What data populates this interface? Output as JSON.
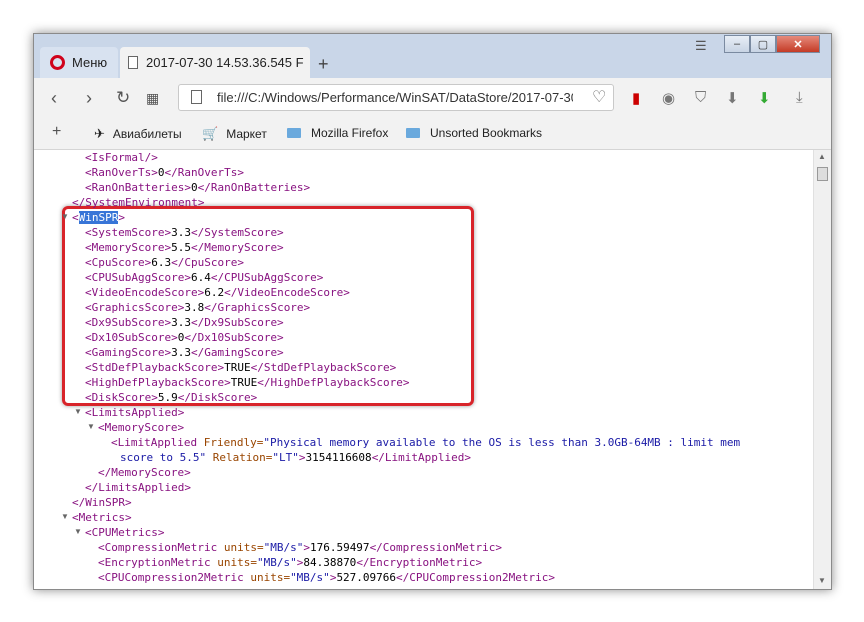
{
  "tabs": {
    "menu_label": "Меню",
    "doc_title": "2017-07-30 14.53.36.545 F"
  },
  "address": {
    "url": "file:///C:/Windows/Performance/WinSAT/DataStore/2017-07-30"
  },
  "bookmarks": [
    {
      "label": "Авиабилеты",
      "icon": "plane-icon"
    },
    {
      "label": "Маркет",
      "icon": "cart-icon"
    },
    {
      "label": "Mozilla Firefox",
      "icon": "folder-icon"
    },
    {
      "label": "Unsorted Bookmarks",
      "icon": "folder-icon"
    }
  ],
  "xml": [
    {
      "o": "<IsFormal/>",
      "v": "",
      "c": ""
    },
    {
      "o": "<RanOverTs>",
      "v": "0",
      "c": "</RanOverTs>"
    },
    {
      "o": "<RanOnBatteries>",
      "v": "0",
      "c": "</RanOnBatteries>"
    },
    {
      "o": "</SystemEnvironment>",
      "v": "",
      "c": ""
    },
    {
      "o": "<",
      "sel": "WinSPR",
      "c": ">"
    },
    {
      "o": "<SystemScore>",
      "v": "3.3",
      "c": "</SystemScore>"
    },
    {
      "o": "<MemoryScore>",
      "v": "5.5",
      "c": "</MemoryScore>"
    },
    {
      "o": "<CpuScore>",
      "v": "6.3",
      "c": "</CpuScore>"
    },
    {
      "o": "<CPUSubAggScore>",
      "v": "6.4",
      "c": "</CPUSubAggScore>"
    },
    {
      "o": "<VideoEncodeScore>",
      "v": "6.2",
      "c": "</VideoEncodeScore>"
    },
    {
      "o": "<GraphicsScore>",
      "v": "3.8",
      "c": "</GraphicsScore>"
    },
    {
      "o": "<Dx9SubScore>",
      "v": "3.3",
      "c": "</Dx9SubScore>"
    },
    {
      "o": "<Dx10SubScore>",
      "v": "0",
      "c": "</Dx10SubScore>"
    },
    {
      "o": "<GamingScore>",
      "v": "3.3",
      "c": "</GamingScore>"
    },
    {
      "o": "<StdDefPlaybackScore>",
      "v": "TRUE",
      "c": "</StdDefPlaybackScore>"
    },
    {
      "o": "<HighDefPlaybackScore>",
      "v": "TRUE",
      "c": "</HighDefPlaybackScore>"
    },
    {
      "o": "<DiskScore>",
      "v": "5.9",
      "c": "</DiskScore>"
    },
    {
      "o": "<LimitsApplied>",
      "v": "",
      "c": ""
    },
    {
      "o": "<MemoryScore>",
      "v": "",
      "c": ""
    },
    {
      "o": "<LimitApplied",
      "a1": " Friendly=",
      "s1": "\"Physical memory available to the OS is less than 3.0GB-64MB : limit mem",
      "c": ""
    },
    {
      "o": "",
      "s1": "score to 5.5\"",
      "a2": " Relation=",
      "s2": "\"LT\"",
      "c2": ">",
      "v": "3154116608",
      "c": "</LimitApplied>"
    },
    {
      "o": "</MemoryScore>",
      "v": "",
      "c": ""
    },
    {
      "o": "</LimitsApplied>",
      "v": "",
      "c": ""
    },
    {
      "o": "</WinSPR>",
      "v": "",
      "c": ""
    },
    {
      "o": "<Metrics>",
      "v": "",
      "c": ""
    },
    {
      "o": "<CPUMetrics>",
      "v": "",
      "c": ""
    },
    {
      "o": "<CompressionMetric",
      "a1": " units=",
      "s1": "\"MB/s\"",
      "c2": ">",
      "v": "176.59497",
      "c": "</CompressionMetric>"
    },
    {
      "o": "<EncryptionMetric",
      "a1": " units=",
      "s1": "\"MB/s\"",
      "c2": ">",
      "v": "84.38870",
      "c": "</EncryptionMetric>"
    },
    {
      "o": "<CPUCompression2Metric",
      "a1": " units=",
      "s1": "\"MB/s\"",
      "c2": ">",
      "v": "527.09766",
      "c": "</CPUCompression2Metric>"
    }
  ],
  "xml_indent": [
    2,
    2,
    2,
    1,
    1,
    2,
    2,
    2,
    2,
    2,
    2,
    2,
    2,
    2,
    2,
    2,
    2,
    2,
    3,
    4,
    4,
    3,
    2,
    1,
    1,
    2,
    3,
    3,
    3
  ],
  "colors": {
    "highlight_box": "#d8242a",
    "tag": "#881280",
    "attr": "#994500",
    "string": "#1a1aa6",
    "selection": "#3875d7"
  }
}
